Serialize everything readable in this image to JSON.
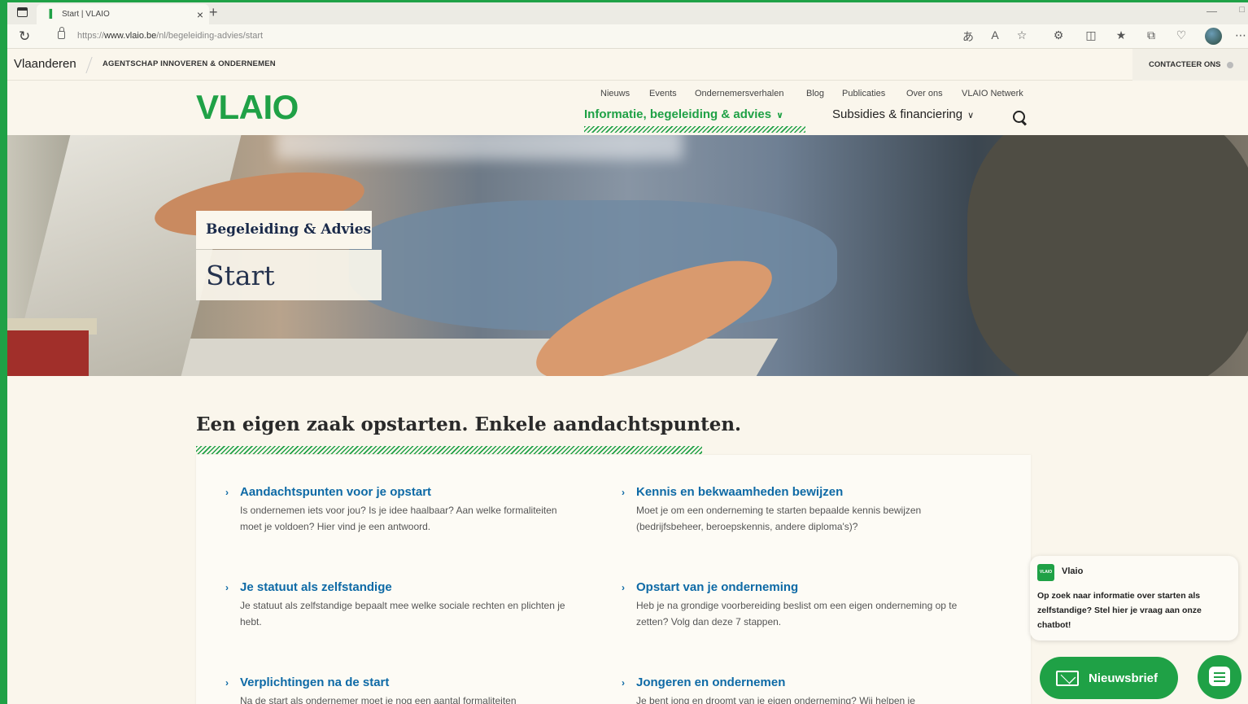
{
  "browser": {
    "tab_title": "Start | VLAIO",
    "url_prefix": "https://",
    "url_host": "www.vlaio.be",
    "url_path": "/nl/begeleiding-advies/start"
  },
  "gov_bar": {
    "region": "Vlaanderen",
    "agency": "AGENTSCHAP INNOVEREN & ONDERNEMEN",
    "contact": "CONTACTEER ONS"
  },
  "header": {
    "logo": "VLAIO",
    "top_nav": [
      "Nieuws",
      "Events",
      "Ondernemersverhalen",
      "Blog",
      "Publicaties",
      "Over ons",
      "VLAIO Netwerk"
    ],
    "main_nav": [
      {
        "label": "Informatie, begeleiding & advies",
        "active": true
      },
      {
        "label": "Subsidies & financiering",
        "active": false
      }
    ]
  },
  "hero": {
    "tag": "Begeleiding & Advies",
    "title": "Start"
  },
  "section": {
    "title": "Een eigen zaak opstarten. Enkele aandachtspunten.",
    "items": [
      {
        "title": "Aandachtspunten voor je opstart",
        "desc": "Is ondernemen iets voor jou? Is je idee haalbaar? Aan welke formaliteiten moet je voldoen? Hier vind je een antwoord."
      },
      {
        "title": "Kennis en bekwaamheden bewijzen",
        "desc": "Moet je om een onderneming te starten bepaalde kennis bewijzen (bedrijfsbeheer, beroepskennis, andere diploma's)?"
      },
      {
        "title": "Je statuut als zelfstandige",
        "desc": "Je statuut als zelfstandige bepaalt mee welke sociale rechten en plichten je hebt."
      },
      {
        "title": "Opstart van je onderneming",
        "desc": "Heb je na grondige voorbereiding beslist om een eigen onderneming op te zetten? Volg dan deze 7 stappen."
      },
      {
        "title": "Verplichtingen na de start",
        "desc": "Na de start als ondernemer moet je nog een aantal formaliteiten"
      },
      {
        "title": "Jongeren en ondernemen",
        "desc": "Je bent jong en droomt van je eigen onderneming? Wij helpen je"
      }
    ]
  },
  "chat": {
    "avatar": "VLAIO",
    "sender": "Vlaio",
    "message": "Op zoek naar informatie over starten als zelfstandige? Stel hier je vraag aan onze chatbot!",
    "newsletter": "Nieuwsbrief"
  },
  "colors": {
    "brand_green": "#1fa146",
    "link_blue": "#0e6aa6",
    "background": "#faf6ec"
  }
}
